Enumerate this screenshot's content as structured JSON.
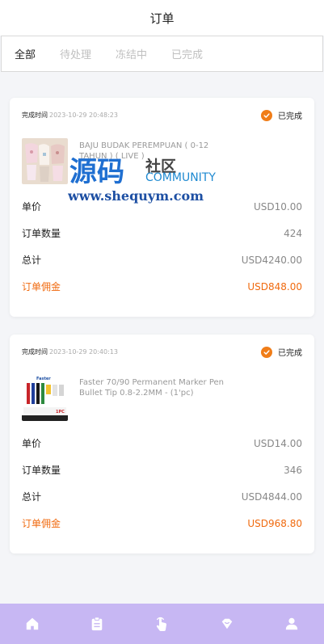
{
  "header": {
    "title": "订单"
  },
  "tabs": [
    {
      "label": "全部",
      "active": true
    },
    {
      "label": "待处理",
      "active": false
    },
    {
      "label": "冻结中",
      "active": false
    },
    {
      "label": "已完成",
      "active": false
    }
  ],
  "orders": [
    {
      "time_label": "完成时间",
      "time": "2023-10-29 20:48:23",
      "status": "已完成",
      "product_name": "BAJU BUDAK PEREMPUAN ( 0-12 TAHUN ) ( LIVE )",
      "rows": [
        {
          "label": "单价",
          "value": "USD10.00"
        },
        {
          "label": "订单数量",
          "value": "424"
        },
        {
          "label": "总计",
          "value": "USD4240.00"
        },
        {
          "label": "订单佣金",
          "value": "USD848.00"
        }
      ]
    },
    {
      "time_label": "完成时间",
      "time": "2023-10-29 20:40:13",
      "status": "已完成",
      "product_name": "Faster 70/90 Permanent Marker Pen Bullet Tip 0.8-2.2MM - (1'pc)",
      "rows": [
        {
          "label": "单价",
          "value": "USD14.00"
        },
        {
          "label": "订单数量",
          "value": "346"
        },
        {
          "label": "总计",
          "value": "USD4844.00"
        },
        {
          "label": "订单佣金",
          "value": "USD968.80"
        }
      ]
    }
  ],
  "watermark": {
    "cn": "源码",
    "sub": "社区",
    "en": "COMMUNITY",
    "url": "www.shequym.com"
  },
  "tabbar": [
    {
      "icon": "home-icon"
    },
    {
      "icon": "clipboard-icon"
    },
    {
      "icon": "tap-hand-icon"
    },
    {
      "icon": "heart-badge-icon"
    },
    {
      "icon": "user-icon"
    }
  ],
  "colors": {
    "accent": "#f06a0f",
    "tabbar": "#c7b7f3",
    "status": "#f07d18"
  }
}
